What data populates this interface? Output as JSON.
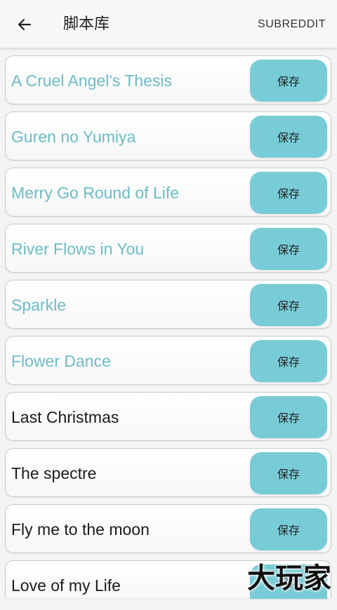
{
  "header": {
    "title": "脚本库",
    "action_label": "SUBREDDIT",
    "back_icon": "arrow-left-icon"
  },
  "colors": {
    "accent": "#78ccd7",
    "highlight_text": "#6cbcc6",
    "normal_text": "#1b1b1b"
  },
  "scripts": [
    {
      "title": "A Cruel Angel's Thesis",
      "button_label": "保存",
      "highlighted": true
    },
    {
      "title": "Guren no Yumiya",
      "button_label": "保存",
      "highlighted": true
    },
    {
      "title": "Merry Go Round of Life",
      "button_label": "保存",
      "highlighted": true
    },
    {
      "title": "River Flows in You",
      "button_label": "保存",
      "highlighted": true
    },
    {
      "title": "Sparkle",
      "button_label": "保存",
      "highlighted": true
    },
    {
      "title": "Flower Dance",
      "button_label": "保存",
      "highlighted": true
    },
    {
      "title": "Last Christmas",
      "button_label": "保存",
      "highlighted": false
    },
    {
      "title": "The spectre",
      "button_label": "保存",
      "highlighted": false
    },
    {
      "title": "Fly me to the moon",
      "button_label": "保存",
      "highlighted": false
    },
    {
      "title": "Love of my Life",
      "button_label": "保存",
      "highlighted": false
    }
  ],
  "watermark": "大玩家"
}
